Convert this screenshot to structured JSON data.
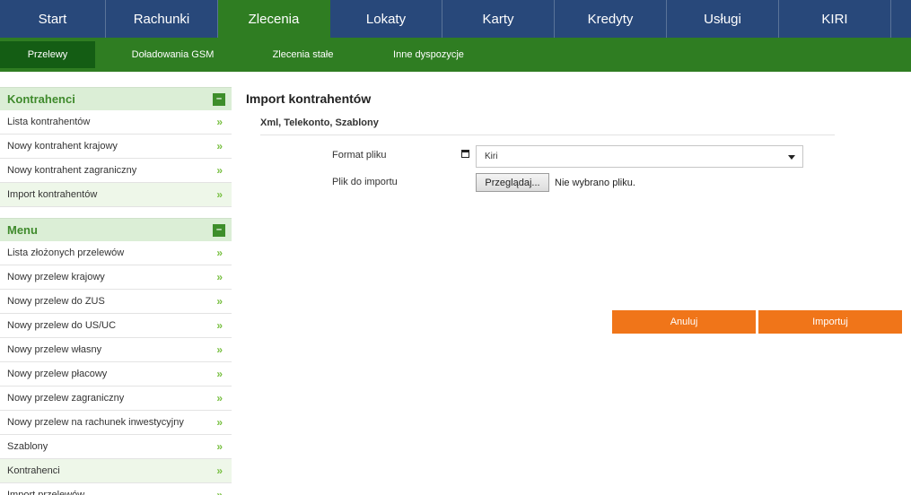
{
  "top_nav": {
    "items": [
      "Start",
      "Rachunki",
      "Zlecenia",
      "Lokaty",
      "Karty",
      "Kredyty",
      "Usługi",
      "KIRI"
    ],
    "active": "Zlecenia"
  },
  "sub_nav": {
    "items": [
      "Przelewy",
      "Doładowania GSM",
      "Zlecenia stałe",
      "Inne dyspozycje"
    ],
    "active": "Przelewy"
  },
  "sidebar": {
    "contractors_panel": {
      "title": "Kontrahenci",
      "collapse": "–",
      "items": [
        "Lista kontrahentów",
        "Nowy kontrahent krajowy",
        "Nowy kontrahent zagraniczny",
        "Import kontrahentów"
      ],
      "active": "Import kontrahentów"
    },
    "menu_panel": {
      "title": "Menu",
      "collapse": "–",
      "items": [
        "Lista złożonych przelewów",
        "Nowy przelew krajowy",
        "Nowy przelew do ZUS",
        "Nowy przelew do US/UC",
        "Nowy przelew własny",
        "Nowy przelew płacowy",
        "Nowy przelew zagraniczny",
        "Nowy przelew na rachunek inwestycyjny",
        "Szablony",
        "Kontrahenci",
        "Import przelewów"
      ],
      "active": "Kontrahenci"
    },
    "chevron": "»"
  },
  "main": {
    "title": "Import kontrahentów",
    "section": "Xml, Telekonto, Szablony",
    "format_label": "Format pliku",
    "format_value": "Kiri",
    "file_label": "Plik do importu",
    "browse_label": "Przeglądaj...",
    "file_status": "Nie wybrano pliku.",
    "cancel_label": "Anuluj",
    "import_label": "Importuj"
  },
  "colors": {
    "top_nav_bg": "#28487a",
    "active_green": "#2f7d22",
    "sub_active": "#145d14",
    "action_orange": "#f07519",
    "sidebar_header_bg": "#dbeed6"
  }
}
